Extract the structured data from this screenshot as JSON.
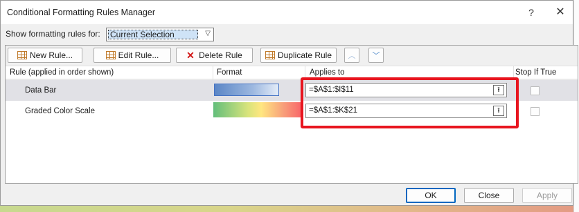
{
  "window": {
    "title": "Conditional Formatting Rules Manager",
    "help_glyph": "?",
    "close_glyph": "✕"
  },
  "show_rules": {
    "label": "Show formatting rules for:",
    "selected": "Current Selection"
  },
  "toolbar": {
    "new_rule": "New Rule...",
    "edit_rule": "Edit Rule...",
    "delete_rule": "Delete Rule",
    "duplicate_rule": "Duplicate Rule",
    "move_up_icon": "chevron-up-icon",
    "move_down_icon": "chevron-down-icon"
  },
  "table": {
    "headers": [
      "Rule (applied in order shown)",
      "Format",
      "Applies to",
      "Stop If True"
    ],
    "rows": [
      {
        "rule": "Data Bar",
        "format": "data-bar-sample",
        "applies_to": "=$A$1:$I$11",
        "stop_if_true": false,
        "selected": true
      },
      {
        "rule": "Graded Color Scale",
        "format": "color-scale-sample",
        "applies_to": "=$A$1:$K$21",
        "stop_if_true": false,
        "selected": false
      }
    ]
  },
  "footer": {
    "ok": "OK",
    "close": "Close",
    "apply": "Apply"
  },
  "colors": {
    "highlight": "#e8151f",
    "selected_row": "#e1e1e6",
    "accent": "#0067c0"
  }
}
